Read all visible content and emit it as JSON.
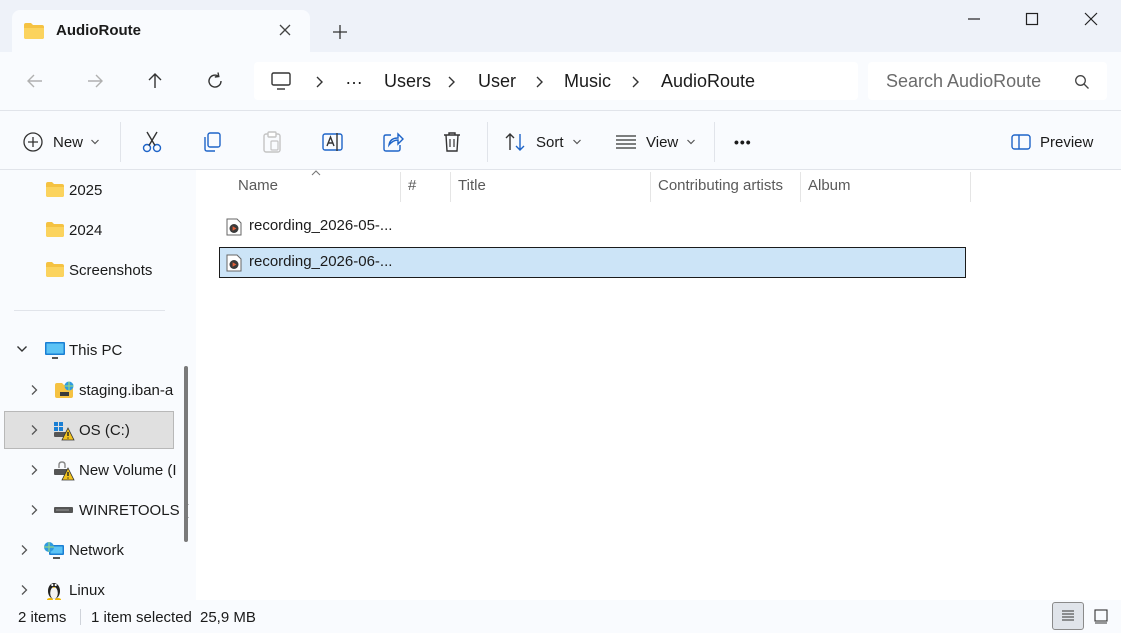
{
  "window": {
    "tab_title": "AudioRoute",
    "new_tab_symbol": "+"
  },
  "address": {
    "root_symbol": "…",
    "crumbs": [
      "Users",
      "User",
      "Music",
      "AudioRoute"
    ]
  },
  "search": {
    "placeholder": "Search AudioRoute"
  },
  "commands": {
    "new_label": "New",
    "sort_label": "Sort",
    "view_label": "View",
    "more_symbol": "•••",
    "preview_label": "Preview"
  },
  "nav": {
    "folders": [
      "2025",
      "2024",
      "Screenshots"
    ],
    "this_pc": "This PC",
    "drives": [
      "staging.iban-a",
      "OS (C:)",
      "New Volume (I",
      "WINRETOOLS ("
    ],
    "network": "Network",
    "linux": "Linux"
  },
  "columns": {
    "name": "Name",
    "number": "#",
    "title": "Title",
    "artists": "Contributing artists",
    "album": "Album"
  },
  "files": [
    {
      "name": "recording_2026-05-...",
      "selected": false
    },
    {
      "name": "recording_2026-06-...",
      "selected": true
    }
  ],
  "status": {
    "items": "2 items",
    "selection": "1 item selected",
    "size": "25,9 MB"
  },
  "colors": {
    "selection": "#cce4f7",
    "folder": "#f5c242",
    "accent": "#0067c0"
  }
}
